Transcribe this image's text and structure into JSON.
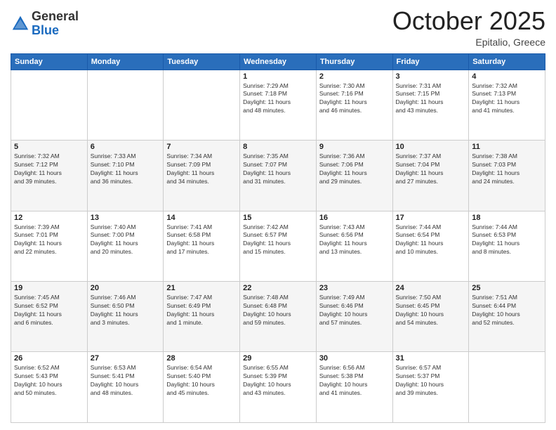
{
  "header": {
    "logo": {
      "general": "General",
      "blue": "Blue"
    },
    "title": "October 2025",
    "location": "Epitalio, Greece"
  },
  "weekdays": [
    "Sunday",
    "Monday",
    "Tuesday",
    "Wednesday",
    "Thursday",
    "Friday",
    "Saturday"
  ],
  "weeks": [
    [
      {
        "day": "",
        "info": ""
      },
      {
        "day": "",
        "info": ""
      },
      {
        "day": "",
        "info": ""
      },
      {
        "day": "1",
        "info": "Sunrise: 7:29 AM\nSunset: 7:18 PM\nDaylight: 11 hours\nand 48 minutes."
      },
      {
        "day": "2",
        "info": "Sunrise: 7:30 AM\nSunset: 7:16 PM\nDaylight: 11 hours\nand 46 minutes."
      },
      {
        "day": "3",
        "info": "Sunrise: 7:31 AM\nSunset: 7:15 PM\nDaylight: 11 hours\nand 43 minutes."
      },
      {
        "day": "4",
        "info": "Sunrise: 7:32 AM\nSunset: 7:13 PM\nDaylight: 11 hours\nand 41 minutes."
      }
    ],
    [
      {
        "day": "5",
        "info": "Sunrise: 7:32 AM\nSunset: 7:12 PM\nDaylight: 11 hours\nand 39 minutes."
      },
      {
        "day": "6",
        "info": "Sunrise: 7:33 AM\nSunset: 7:10 PM\nDaylight: 11 hours\nand 36 minutes."
      },
      {
        "day": "7",
        "info": "Sunrise: 7:34 AM\nSunset: 7:09 PM\nDaylight: 11 hours\nand 34 minutes."
      },
      {
        "day": "8",
        "info": "Sunrise: 7:35 AM\nSunset: 7:07 PM\nDaylight: 11 hours\nand 31 minutes."
      },
      {
        "day": "9",
        "info": "Sunrise: 7:36 AM\nSunset: 7:06 PM\nDaylight: 11 hours\nand 29 minutes."
      },
      {
        "day": "10",
        "info": "Sunrise: 7:37 AM\nSunset: 7:04 PM\nDaylight: 11 hours\nand 27 minutes."
      },
      {
        "day": "11",
        "info": "Sunrise: 7:38 AM\nSunset: 7:03 PM\nDaylight: 11 hours\nand 24 minutes."
      }
    ],
    [
      {
        "day": "12",
        "info": "Sunrise: 7:39 AM\nSunset: 7:01 PM\nDaylight: 11 hours\nand 22 minutes."
      },
      {
        "day": "13",
        "info": "Sunrise: 7:40 AM\nSunset: 7:00 PM\nDaylight: 11 hours\nand 20 minutes."
      },
      {
        "day": "14",
        "info": "Sunrise: 7:41 AM\nSunset: 6:58 PM\nDaylight: 11 hours\nand 17 minutes."
      },
      {
        "day": "15",
        "info": "Sunrise: 7:42 AM\nSunset: 6:57 PM\nDaylight: 11 hours\nand 15 minutes."
      },
      {
        "day": "16",
        "info": "Sunrise: 7:43 AM\nSunset: 6:56 PM\nDaylight: 11 hours\nand 13 minutes."
      },
      {
        "day": "17",
        "info": "Sunrise: 7:44 AM\nSunset: 6:54 PM\nDaylight: 11 hours\nand 10 minutes."
      },
      {
        "day": "18",
        "info": "Sunrise: 7:44 AM\nSunset: 6:53 PM\nDaylight: 11 hours\nand 8 minutes."
      }
    ],
    [
      {
        "day": "19",
        "info": "Sunrise: 7:45 AM\nSunset: 6:52 PM\nDaylight: 11 hours\nand 6 minutes."
      },
      {
        "day": "20",
        "info": "Sunrise: 7:46 AM\nSunset: 6:50 PM\nDaylight: 11 hours\nand 3 minutes."
      },
      {
        "day": "21",
        "info": "Sunrise: 7:47 AM\nSunset: 6:49 PM\nDaylight: 11 hours\nand 1 minute."
      },
      {
        "day": "22",
        "info": "Sunrise: 7:48 AM\nSunset: 6:48 PM\nDaylight: 10 hours\nand 59 minutes."
      },
      {
        "day": "23",
        "info": "Sunrise: 7:49 AM\nSunset: 6:46 PM\nDaylight: 10 hours\nand 57 minutes."
      },
      {
        "day": "24",
        "info": "Sunrise: 7:50 AM\nSunset: 6:45 PM\nDaylight: 10 hours\nand 54 minutes."
      },
      {
        "day": "25",
        "info": "Sunrise: 7:51 AM\nSunset: 6:44 PM\nDaylight: 10 hours\nand 52 minutes."
      }
    ],
    [
      {
        "day": "26",
        "info": "Sunrise: 6:52 AM\nSunset: 5:43 PM\nDaylight: 10 hours\nand 50 minutes."
      },
      {
        "day": "27",
        "info": "Sunrise: 6:53 AM\nSunset: 5:41 PM\nDaylight: 10 hours\nand 48 minutes."
      },
      {
        "day": "28",
        "info": "Sunrise: 6:54 AM\nSunset: 5:40 PM\nDaylight: 10 hours\nand 45 minutes."
      },
      {
        "day": "29",
        "info": "Sunrise: 6:55 AM\nSunset: 5:39 PM\nDaylight: 10 hours\nand 43 minutes."
      },
      {
        "day": "30",
        "info": "Sunrise: 6:56 AM\nSunset: 5:38 PM\nDaylight: 10 hours\nand 41 minutes."
      },
      {
        "day": "31",
        "info": "Sunrise: 6:57 AM\nSunset: 5:37 PM\nDaylight: 10 hours\nand 39 minutes."
      },
      {
        "day": "",
        "info": ""
      }
    ]
  ]
}
